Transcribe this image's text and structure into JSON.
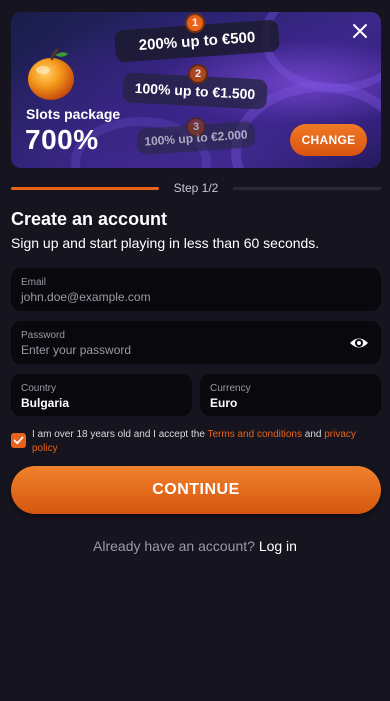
{
  "banner": {
    "package_title": "Slots package",
    "package_percent": "700%",
    "tiers": [
      {
        "number": "1",
        "text": "200% up to €500"
      },
      {
        "number": "2",
        "text": "100% up to €1.500"
      },
      {
        "number": "3",
        "text": "100% up to €2.000"
      }
    ],
    "change_label": "CHANGE",
    "close_icon": "close-icon",
    "fruit_icon": "orange-fruit-icon"
  },
  "step": {
    "label": "Step 1/2",
    "progress": 0.5
  },
  "form": {
    "title": "Create an account",
    "subtitle": "Sign up and start playing in less than 60 seconds.",
    "email": {
      "label": "Email",
      "placeholder": "john.doe@example.com"
    },
    "password": {
      "label": "Password",
      "placeholder": "Enter your password"
    },
    "country": {
      "label": "Country",
      "value": "Bulgaria"
    },
    "currency": {
      "label": "Currency",
      "value": "Euro"
    },
    "terms": {
      "checked": true,
      "prefix": "I am over 18 years old and I accept the ",
      "terms_link": "Terms and conditions",
      "middle": " and ",
      "privacy_link": "privacy policy"
    },
    "continue_label": "CONTINUE",
    "login_prompt": "Already have an account?",
    "login_link": "Log in"
  },
  "colors": {
    "accent": "#e8621a",
    "background": "#15141f",
    "field": "#08080d"
  }
}
